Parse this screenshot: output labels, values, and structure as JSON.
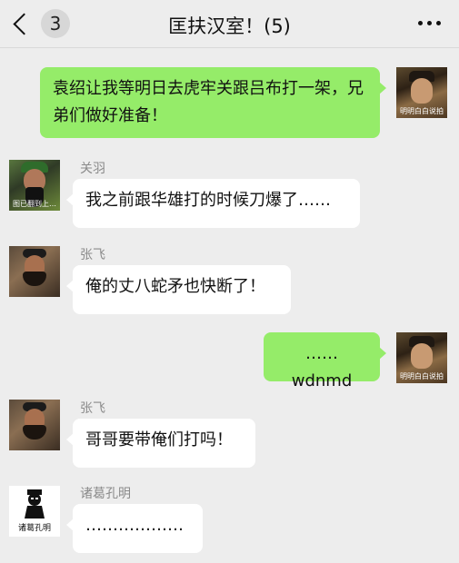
{
  "header": {
    "back_icon": "chevron-left-icon",
    "unread_count": "3",
    "title": "匡扶汉室！(5)",
    "more_icon": "more-dots-icon"
  },
  "avatars": {
    "liu_caption": "明明白白说拍",
    "guan_caption": "图已翻到上…",
    "zhuge_caption": "诸葛孔明"
  },
  "messages": [
    {
      "side": "out",
      "sender": "",
      "text": "袁绍让我等明日去虎牢关跟吕布打一架，兄弟们做好准备！"
    },
    {
      "side": "in",
      "sender": "关羽",
      "text": "我之前跟华雄打的时候刀爆了……"
    },
    {
      "side": "in",
      "sender": "张飞",
      "text": "俺的丈八蛇矛也快断了！"
    },
    {
      "side": "out",
      "sender": "",
      "text": "……wdnmd"
    },
    {
      "side": "in",
      "sender": "张飞",
      "text": "哥哥要带俺们打吗！"
    },
    {
      "side": "in",
      "sender": "诸葛孔明",
      "text": "………………"
    }
  ],
  "colors": {
    "background": "#ededed",
    "outgoing_bubble": "#95ec69",
    "incoming_bubble": "#ffffff"
  }
}
